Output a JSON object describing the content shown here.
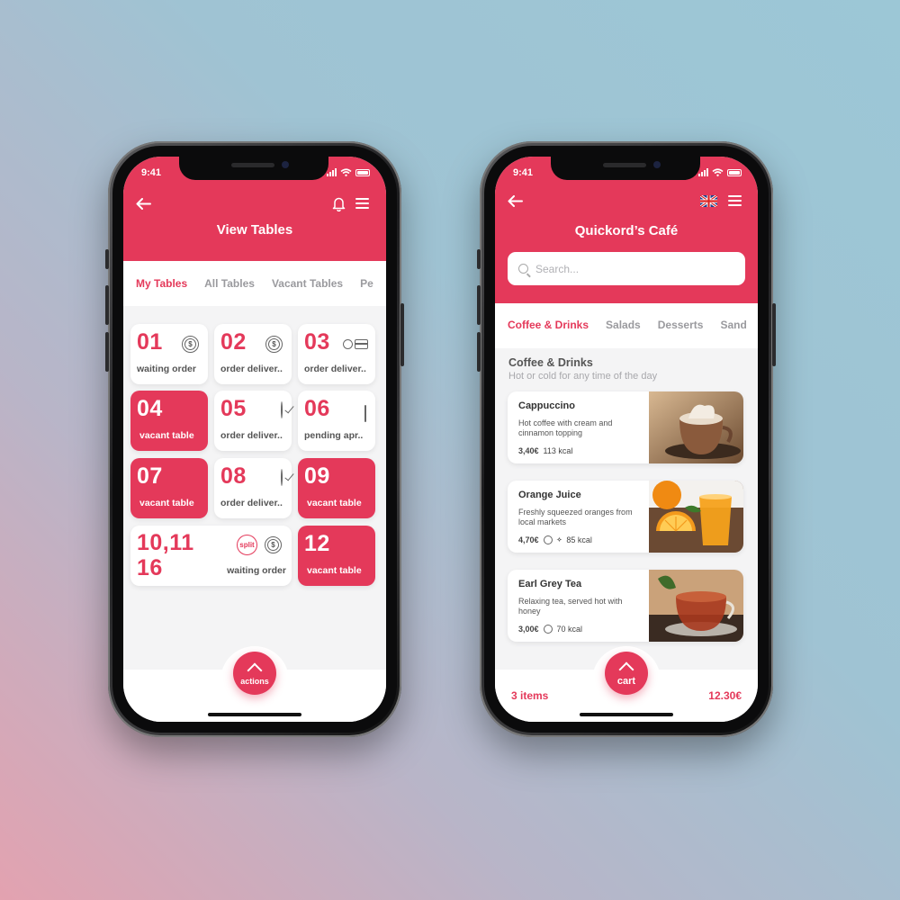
{
  "status": {
    "time": "9:41"
  },
  "tables_screen": {
    "title": "View Tables",
    "tabs": [
      {
        "label": "My Tables",
        "active": true
      },
      {
        "label": "All Tables",
        "active": false
      },
      {
        "label": "Vacant Tables",
        "active": false
      },
      {
        "label": "Pe",
        "active": false
      }
    ],
    "tables": [
      {
        "number": "01",
        "status": "waiting order",
        "vacant": false,
        "icon": "dollar-coin-icon"
      },
      {
        "number": "02",
        "status": "order deliver..",
        "vacant": false,
        "icon": "dollar-coin-icon"
      },
      {
        "number": "03",
        "status": "order deliver..",
        "vacant": false,
        "icon": "cash-card-icon"
      },
      {
        "number": "04",
        "status": "vacant table",
        "vacant": true,
        "icon": ""
      },
      {
        "number": "05",
        "status": "order deliver..",
        "vacant": false,
        "icon": "check-circle-icon"
      },
      {
        "number": "06",
        "status": "pending apr..",
        "vacant": false,
        "icon": "credit-card-icon"
      },
      {
        "number": "07",
        "status": "vacant table",
        "vacant": true,
        "icon": ""
      },
      {
        "number": "08",
        "status": "order deliver..",
        "vacant": false,
        "icon": "check-circle-icon"
      },
      {
        "number": "09",
        "status": "vacant table",
        "vacant": true,
        "icon": ""
      },
      {
        "number": "12",
        "status": "vacant table",
        "vacant": true,
        "icon": ""
      }
    ],
    "merged_table": {
      "number_line1": "10,11",
      "number_line2": "16",
      "status": "waiting order",
      "split_label": "split"
    },
    "actions_label": "actions"
  },
  "cafe_screen": {
    "title": "Quickord’s Café",
    "search_placeholder": "Search...",
    "tabs": [
      {
        "label": "Coffee & Drinks",
        "active": true
      },
      {
        "label": "Salads",
        "active": false
      },
      {
        "label": "Desserts",
        "active": false
      },
      {
        "label": "Sand",
        "active": false
      }
    ],
    "section_title": "Coffee & Drinks",
    "section_subtitle": "Hot or cold for any time of the day",
    "items": [
      {
        "name": "Cappuccino",
        "description": "Hot coffee with cream and cinnamon topping",
        "price": "3,40€",
        "kcal": "113 kcal"
      },
      {
        "name": "Orange Juice",
        "description": "Freshly squeezed oranges from local markets",
        "price": "4,70€",
        "kcal": "85 kcal"
      },
      {
        "name": "Earl Grey Tea",
        "description": "Relaxing tea, served hot with honey",
        "price": "3,00€",
        "kcal": "70 kcal"
      }
    ],
    "cart_label": "cart",
    "items_count": "3 items",
    "total": "12.30€"
  },
  "colors": {
    "accent": "#e4395a",
    "background_light": "#f4f4f5"
  }
}
